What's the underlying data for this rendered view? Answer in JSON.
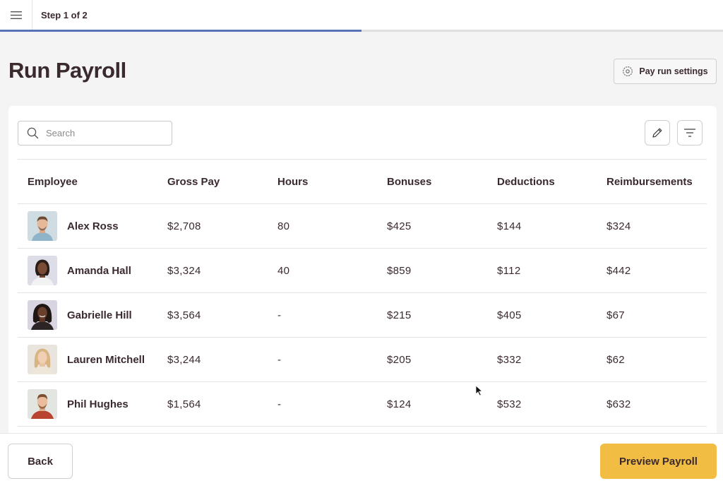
{
  "topbar": {
    "step_label": "Step 1 of 2",
    "progress": 0.5
  },
  "header": {
    "title": "Run Payroll",
    "settings_label": "Pay run settings"
  },
  "search": {
    "placeholder": "Search",
    "value": ""
  },
  "table": {
    "columns": [
      "Employee",
      "Gross Pay",
      "Hours",
      "Bonuses",
      "Deductions",
      "Reimbursements"
    ],
    "rows": [
      {
        "name": "Alex Ross",
        "gross": "$2,708",
        "hours": "80",
        "bonus": "$425",
        "deductions": "$144",
        "reimbursements": "$324"
      },
      {
        "name": "Amanda Hall",
        "gross": "$3,324",
        "hours": "40",
        "bonus": "$859",
        "deductions": "$112",
        "reimbursements": "$442"
      },
      {
        "name": "Gabrielle Hill",
        "gross": "$3,564",
        "hours": "-",
        "bonus": "$215",
        "deductions": "$405",
        "reimbursements": "$67"
      },
      {
        "name": "Lauren Mitchell",
        "gross": "$3,244",
        "hours": "-",
        "bonus": "$205",
        "deductions": "$332",
        "reimbursements": "$62"
      },
      {
        "name": "Phil Hughes",
        "gross": "$1,564",
        "hours": "-",
        "bonus": "$124",
        "deductions": "$532",
        "reimbursements": "$632"
      }
    ]
  },
  "footer": {
    "back_label": "Back",
    "preview_label": "Preview Payroll"
  },
  "colors": {
    "accent": "#f2bd43",
    "progress": "#5a72b8",
    "text": "#3a2a2e"
  }
}
